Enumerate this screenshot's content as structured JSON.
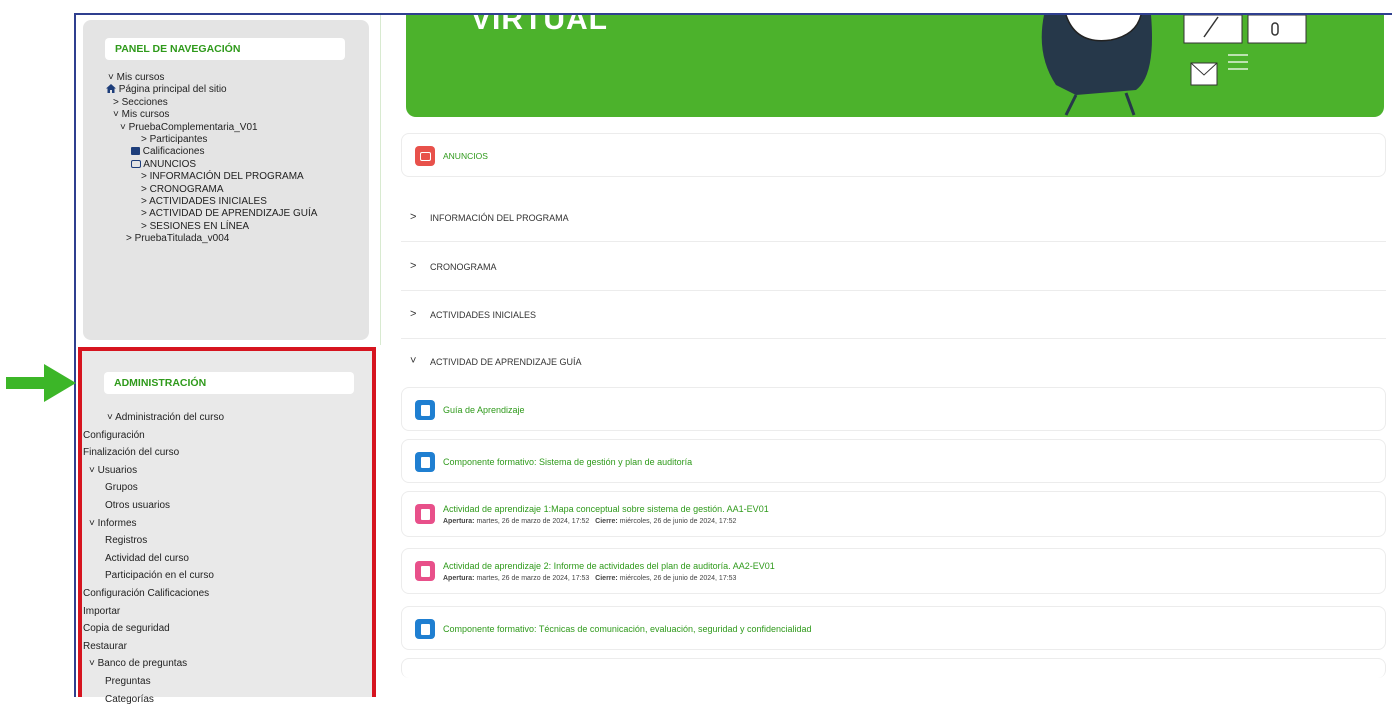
{
  "banner": {
    "title": "VIRTUAL"
  },
  "nav": {
    "title": "PANEL DE NAVEGACIÓN",
    "items": [
      "Mis cursos",
      "Página principal del sitio",
      "Secciones",
      "Mis cursos",
      "PruebaComplementaria_V01",
      "Participantes",
      "Calificaciones",
      "ANUNCIOS",
      "INFORMACIÓN DEL PROGRAMA",
      "CRONOGRAMA",
      "ACTIVIDADES INICIALES",
      "ACTIVIDAD DE APRENDIZAJE GUÍA",
      "SESIONES EN LÍNEA",
      "PruebaTitulada_v004"
    ]
  },
  "admin": {
    "title": "ADMINISTRACIÓN",
    "items": [
      "Administración del curso",
      "Configuración",
      "Finalización del curso",
      "Usuarios",
      "Grupos",
      "Otros usuarios",
      "Informes",
      "Registros",
      "Actividad del curso",
      "Participación en el curso",
      "Configuración Calificaciones",
      "Importar",
      "Copia de seguridad",
      "Restaurar",
      "Banco de preguntas",
      "Preguntas",
      "Categorías"
    ]
  },
  "main": {
    "announcements": "ANUNCIOS",
    "sections": [
      "INFORMACIÓN DEL PROGRAMA",
      "CRONOGRAMA",
      "ACTIVIDADES INICIALES",
      "ACTIVIDAD DE APRENDIZAJE GUÍA"
    ],
    "activities": [
      {
        "title": "Guía de Aprendizaje"
      },
      {
        "title": "Componente formativo: Sistema de gestión y plan de auditoría"
      },
      {
        "title": "Actividad de aprendizaje 1:Mapa conceptual sobre sistema de gestión. AA1-EV01",
        "open_label": "Apertura:",
        "open_date": "martes, 26 de marzo de 2024, 17:52",
        "close_label": "Cierre:",
        "close_date": "miércoles, 26 de junio de 2024, 17:52"
      },
      {
        "title": "Actividad de aprendizaje 2: Informe de actividades del plan de auditoría. AA2-EV01",
        "open_label": "Apertura:",
        "open_date": "martes, 26 de marzo de 2024, 17:53",
        "close_label": "Cierre:",
        "close_date": "miércoles, 26 de junio de 2024, 17:53"
      },
      {
        "title": "Componente formativo: Técnicas de comunicación, evaluación, seguridad y confidencialidad"
      }
    ]
  },
  "colors": {
    "accent_green": "#2f9a1b",
    "highlight_red": "#d6141f",
    "banner_green": "#4cb22c",
    "arrow_green": "#3cb628"
  }
}
